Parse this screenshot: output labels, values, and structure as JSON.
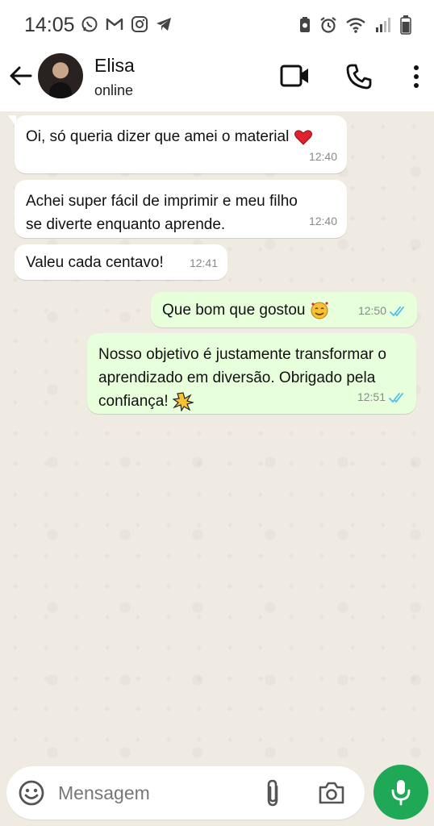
{
  "status_bar": {
    "time": "14:05",
    "left_icons": [
      "whatsapp-icon",
      "gmail-icon",
      "instagram-icon",
      "telegram-icon"
    ],
    "right_icons": [
      "battery-saver-icon",
      "alarm-icon",
      "wifi-icon",
      "signal-icon",
      "battery-icon"
    ]
  },
  "header": {
    "contact_name": "Elisa",
    "contact_status": "online",
    "icons": [
      "back-arrow-icon",
      "video-call-icon",
      "phone-icon",
      "more-vert-icon"
    ]
  },
  "messages": [
    {
      "direction": "in",
      "text": "Oi, só queria dizer que amei o material",
      "emoji": "red-heart",
      "time": "12:40"
    },
    {
      "direction": "in",
      "text": "Achei super fácil de imprimir e meu filho se diverte enquanto aprende.",
      "time": "12:40"
    },
    {
      "direction": "in",
      "text": "Valeu cada centavo!",
      "time": "12:41"
    },
    {
      "direction": "out",
      "text": "Que bom que gostou",
      "emoji": "smiling-face-with-hearts",
      "time": "12:50",
      "read": true
    },
    {
      "direction": "out",
      "text": "Nosso objetivo é justamente transformar o aprendizado em diversão. Obrigado pela confiança!",
      "emoji": "sparkle-burst",
      "time": "12:51",
      "read": true
    }
  ],
  "composer": {
    "placeholder": "Mensagem",
    "icons": [
      "emoji-icon",
      "attach-icon",
      "camera-icon",
      "mic-icon"
    ]
  },
  "colors": {
    "chat_bg": "#efeae2",
    "outgoing_bubble": "#e7ffdb",
    "incoming_bubble": "#ffffff",
    "mic_button": "#1fa855",
    "read_ticks": "#53bdeb"
  }
}
